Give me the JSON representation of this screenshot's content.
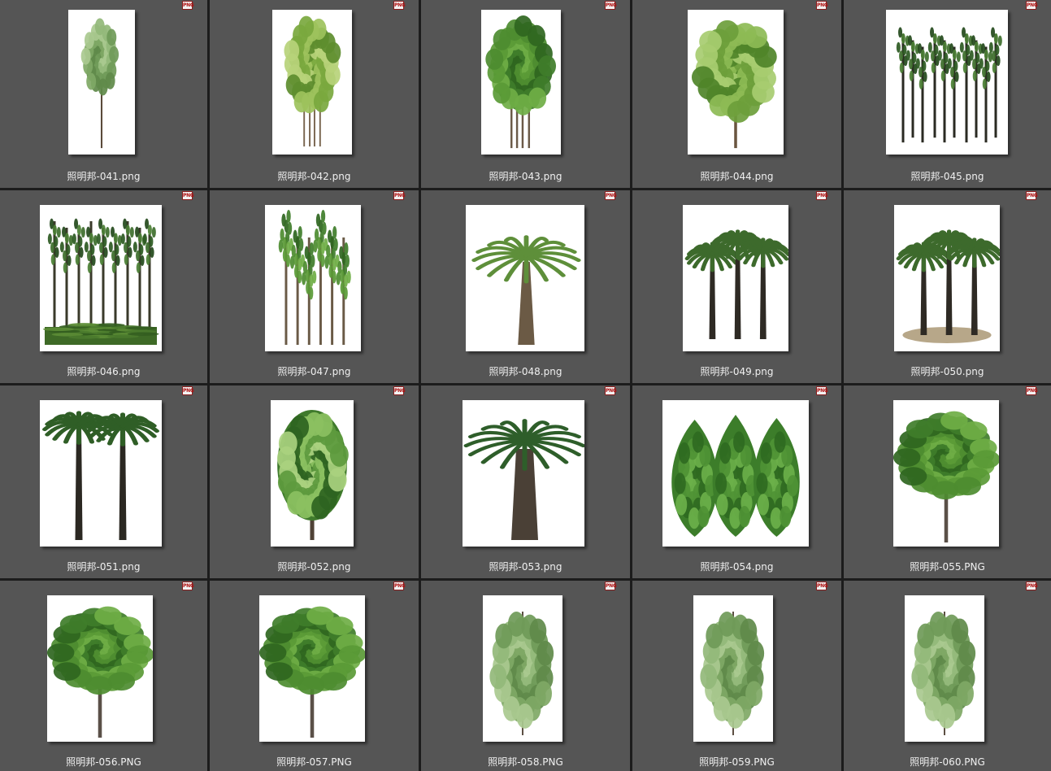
{
  "view": {
    "badge_label": "PNG",
    "files": [
      {
        "name": "照明邦-041.png",
        "thumb_icon": "tall-tree-icon"
      },
      {
        "name": "照明邦-042.png",
        "thumb_icon": "multi-trunk-tree-icon"
      },
      {
        "name": "照明邦-043.png",
        "thumb_icon": "bushy-tree-icon"
      },
      {
        "name": "照明邦-044.png",
        "thumb_icon": "branchy-tree-icon"
      },
      {
        "name": "照明邦-045.png",
        "thumb_icon": "bamboo-group-icon"
      },
      {
        "name": "照明邦-046.png",
        "thumb_icon": "bamboo-hedge-icon"
      },
      {
        "name": "照明邦-047.png",
        "thumb_icon": "slender-tree-group-icon"
      },
      {
        "name": "照明邦-048.png",
        "thumb_icon": "date-palm-icon"
      },
      {
        "name": "照明邦-049.png",
        "thumb_icon": "palm-trio-icon"
      },
      {
        "name": "照明邦-050.png",
        "thumb_icon": "palm-trio-ground-icon"
      },
      {
        "name": "照明邦-051.png",
        "thumb_icon": "palm-pair-icon"
      },
      {
        "name": "照明邦-052.png",
        "thumb_icon": "topiary-tree-icon"
      },
      {
        "name": "照明邦-053.png",
        "thumb_icon": "fan-palm-icon"
      },
      {
        "name": "照明邦-054.png",
        "thumb_icon": "cypress-trio-icon"
      },
      {
        "name": "照明邦-055.PNG",
        "thumb_icon": "round-tree-icon"
      },
      {
        "name": "照明邦-056.PNG",
        "thumb_icon": "round-tree-icon"
      },
      {
        "name": "照明邦-057.PNG",
        "thumb_icon": "round-tree-icon"
      },
      {
        "name": "照明邦-058.PNG",
        "thumb_icon": "sparse-tree-icon"
      },
      {
        "name": "照明邦-059.PNG",
        "thumb_icon": "sparse-tree-icon"
      },
      {
        "name": "照明邦-060.PNG",
        "thumb_icon": "sparse-tree-icon"
      }
    ]
  }
}
